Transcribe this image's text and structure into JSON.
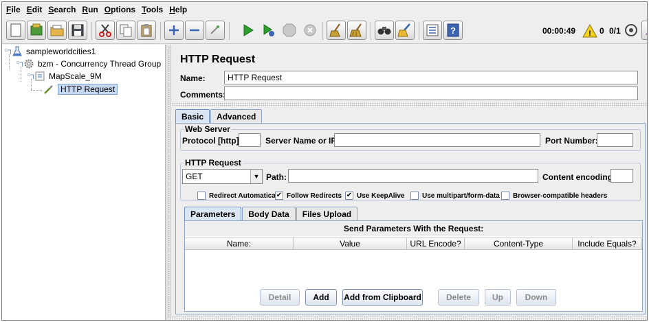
{
  "menu": [
    {
      "mn": "F",
      "rest": "ile"
    },
    {
      "mn": "E",
      "rest": "dit"
    },
    {
      "mn": "S",
      "rest": "earch"
    },
    {
      "mn": "R",
      "rest": "un"
    },
    {
      "mn": "O",
      "rest": "ptions"
    },
    {
      "mn": "T",
      "rest": "ools"
    },
    {
      "mn": "H",
      "rest": "elp"
    }
  ],
  "status": {
    "elapsed": "00:00:49",
    "warnings": "0",
    "threads": "0/1"
  },
  "tree": {
    "root": "sampleworldcities1",
    "thread_group": "bzm - Concurrency Thread Group",
    "controller": "MapScale_9M",
    "sampler": "HTTP Request"
  },
  "panel": {
    "title": "HTTP Request",
    "name_label": "Name:",
    "name_value": "HTTP Request",
    "comments_label": "Comments:",
    "comments_value": "",
    "tabs": [
      "Basic",
      "Advanced"
    ],
    "web_server": {
      "title": "Web Server",
      "protocol_label": "Protocol [http]:",
      "protocol_value": "",
      "server_label": "Server Name or IP:",
      "server_value": "",
      "port_label": "Port Number:",
      "port_value": ""
    },
    "http_request": {
      "title": "HTTP Request",
      "method": "GET",
      "path_label": "Path:",
      "path_value": "",
      "encoding_label": "Content encoding:",
      "encoding_value": ""
    },
    "checkboxes": [
      {
        "label": "Redirect Automatically",
        "checked": false,
        "mark": ""
      },
      {
        "label": "Follow Redirects",
        "checked": true,
        "mark": "✔"
      },
      {
        "label": "Use KeepAlive",
        "checked": true,
        "mark": "✔"
      },
      {
        "label": "Use multipart/form-data",
        "checked": false,
        "mark": ""
      },
      {
        "label": "Browser-compatible headers",
        "checked": false,
        "mark": ""
      }
    ],
    "subtabs": [
      "Parameters",
      "Body Data",
      "Files Upload"
    ],
    "params_table": {
      "caption": "Send Parameters With the Request:",
      "columns": [
        "Name:",
        "Value",
        "URL Encode?",
        "Content-Type",
        "Include Equals?"
      ]
    },
    "buttons": {
      "detail": "Detail",
      "add": "Add",
      "add_clipboard": "Add from Clipboard",
      "delete": "Delete",
      "up": "Up",
      "down": "Down"
    }
  }
}
